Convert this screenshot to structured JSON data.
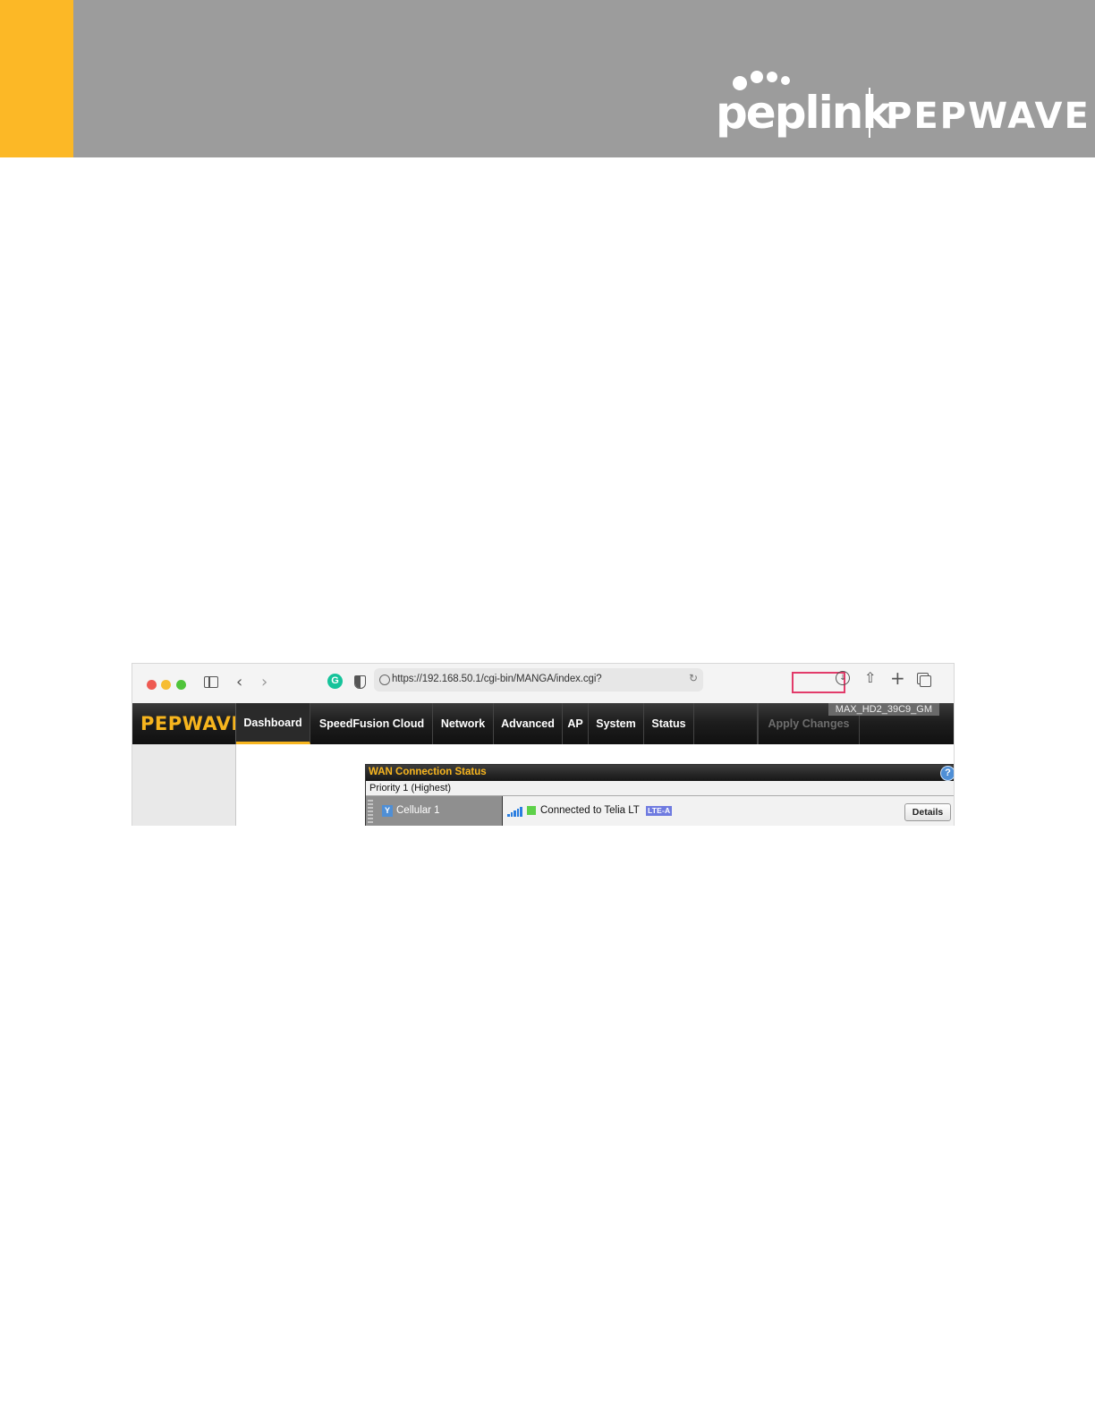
{
  "header": {
    "brand_primary": "peplink",
    "brand_secondary": "PEPWAVE",
    "colors": {
      "band": "#9c9c9c",
      "accent": "#fcb826"
    }
  },
  "browser": {
    "url": "https://192.168.50.1/cgi-bin/MANGA/index.cgi?",
    "icons": [
      "sidebar-icon",
      "back-icon",
      "forward-icon",
      "grammarly-icon",
      "shield-icon",
      "globe-icon",
      "reload-icon",
      "download-icon",
      "share-icon",
      "new-tab-icon",
      "tabs-overview-icon"
    ]
  },
  "app": {
    "logo": "PEPWAVE",
    "device_name": "MAX_HD2_39C9_GM",
    "nav": {
      "items": [
        "Dashboard",
        "SpeedFusion Cloud",
        "Network",
        "Advanced",
        "AP",
        "System",
        "Status"
      ],
      "active": "Dashboard",
      "apply_changes": "Apply Changes"
    },
    "wan_panel": {
      "title": "WAN Connection Status",
      "priority_label": "Priority 1 (Highest)",
      "connection": {
        "name": "Cellular 1",
        "status": "Connected to Telia LT",
        "technology_badge": "LTE-A",
        "details_button": "Details",
        "status_color": "#5ed14a"
      }
    },
    "colors": {
      "accent": "#f7b51e",
      "nav_bg": "#1e1e1e"
    }
  }
}
